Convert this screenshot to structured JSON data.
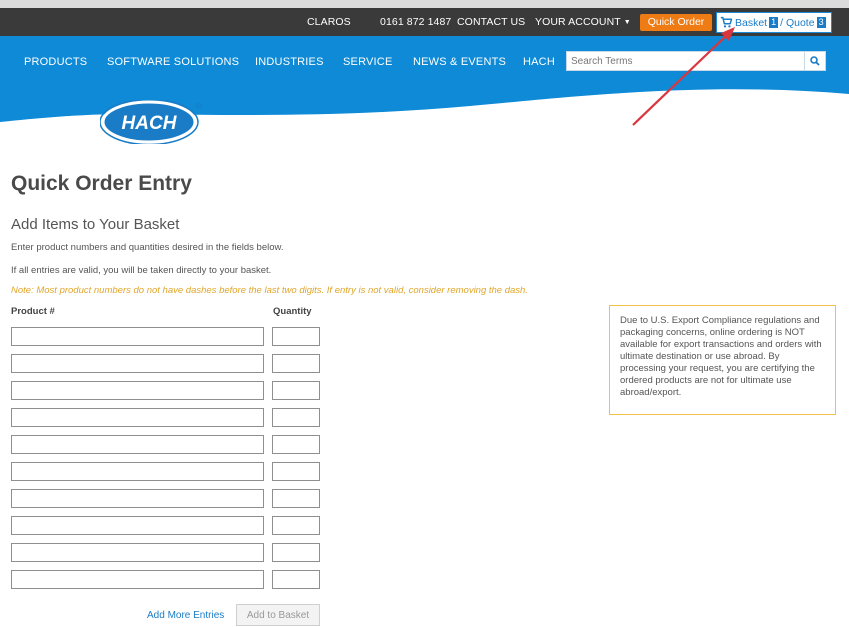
{
  "utility_bar": {
    "links": [
      "CLAROS",
      "0161 872 1487",
      "CONTACT US",
      "YOUR ACCOUNT"
    ],
    "quick_order": "Quick Order",
    "basket_label": "Basket",
    "basket_count": "1",
    "quote_label": "/ Quote",
    "quote_count": "3"
  },
  "nav": {
    "items": [
      "PRODUCTS",
      "SOFTWARE SOLUTIONS",
      "INDUSTRIES",
      "SERVICE",
      "NEWS & EVENTS",
      "HACH"
    ],
    "search_placeholder": "Search Terms"
  },
  "logo_text": "HACH",
  "page": {
    "title": "Quick Order Entry",
    "section_title": "Add Items to Your Basket",
    "info_1": "Enter product numbers and quantities desired in the fields below.",
    "info_2": "If all entries are valid, you will be taken directly to your basket.",
    "note": "Note: Most product numbers do not have dashes before the last two digits. If entry is not valid, consider removing the dash.",
    "col_product": "Product #",
    "col_quantity": "Quantity",
    "add_more": "Add More Entries",
    "add_to_basket": "Add to Basket"
  },
  "export_notice": "Due to U.S. Export Compliance regulations and packaging concerns, online ordering is NOT available for export transactions and orders with ultimate destination or use abroad. By processing your request, you are certifying the ordered products are not for ultimate use abroad/export.",
  "colors": {
    "nav_blue": "#0f8ad6",
    "utility_dark": "#3a3a3a",
    "quick_order_orange": "#ef7b14",
    "link_blue": "#1a7cc6",
    "note_yellow": "#e0a62a",
    "annotation_arrow": "#d9363e"
  }
}
